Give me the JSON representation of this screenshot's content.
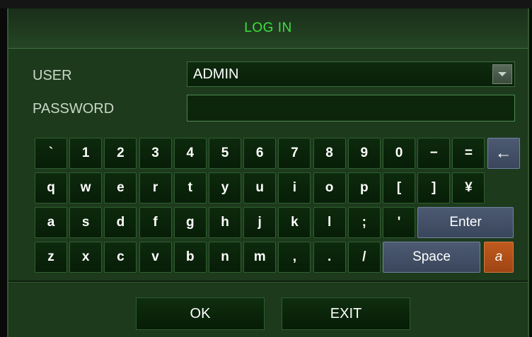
{
  "dialog": {
    "title": "LOG IN",
    "user_label": "USER",
    "user_value": "ADMIN",
    "password_label": "PASSWORD",
    "password_value": ""
  },
  "keyboard": {
    "row1": [
      "`",
      "1",
      "2",
      "3",
      "4",
      "5",
      "6",
      "7",
      "8",
      "9",
      "0",
      "−",
      "=",
      "←"
    ],
    "row2": [
      "q",
      "w",
      "e",
      "r",
      "t",
      "y",
      "u",
      "i",
      "o",
      "p",
      "[",
      "]",
      "¥"
    ],
    "row3": [
      "a",
      "s",
      "d",
      "f",
      "g",
      "h",
      "j",
      "k",
      "l",
      ";",
      "'",
      "Enter"
    ],
    "row4": [
      "z",
      "x",
      "c",
      "v",
      "b",
      "n",
      "m",
      ",",
      ".",
      "/",
      "Space",
      "a"
    ]
  },
  "buttons": {
    "ok": "OK",
    "exit": "EXIT"
  },
  "colors": {
    "title": "#3fe03f",
    "panel": "#1d3a1d",
    "special_key": "#4c5a72",
    "case_key": "#c05a1e"
  },
  "icons": {
    "backspace": "backspace-arrow-icon",
    "dropdown": "chevron-down-icon"
  }
}
